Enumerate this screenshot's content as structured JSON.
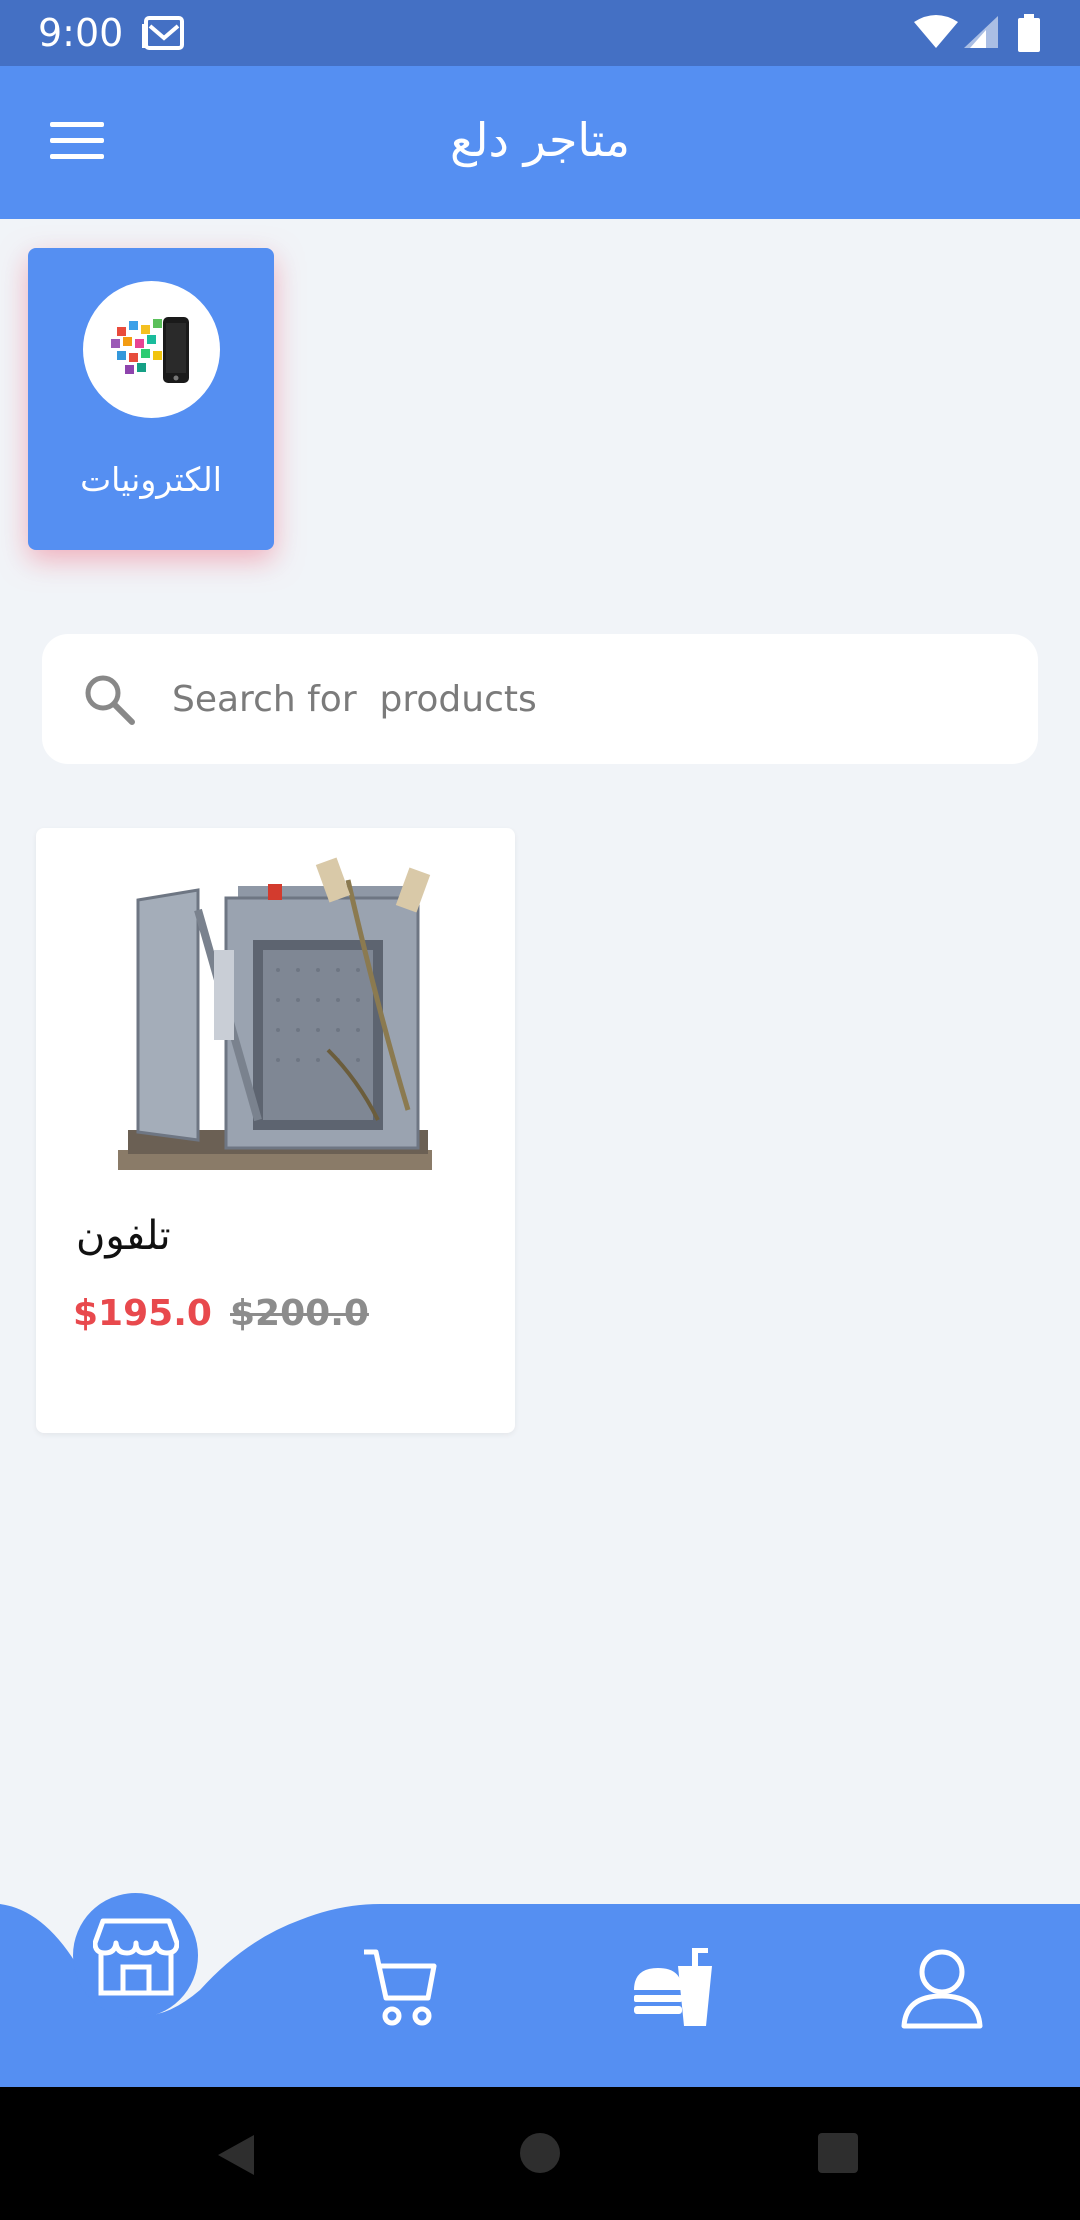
{
  "status_bar": {
    "time": "9:00",
    "icons": [
      "mail-icon",
      "wifi-icon",
      "signal-icon",
      "battery-icon"
    ]
  },
  "app_bar": {
    "title": "متاجر دلع",
    "menu_icon": "menu-icon"
  },
  "categories": [
    {
      "label": "الكترونيات",
      "icon": "phone-apps-icon"
    }
  ],
  "search": {
    "placeholder": "Search for  products",
    "value": ""
  },
  "products": [
    {
      "name": "تلفون",
      "price": "$195.0",
      "old_price": "$200.0",
      "image": "industrial-oven-image"
    }
  ],
  "bottom_nav": {
    "items": [
      "store-icon",
      "cart-icon",
      "food-icon",
      "profile-icon"
    ],
    "active": "store-icon"
  },
  "colors": {
    "primary": "#558ff2",
    "status_bar": "#4470c4",
    "background": "#f1f4f8",
    "price": "#e8494d",
    "old_price": "#8c8c8c",
    "category_shadow": "#f0788c"
  }
}
